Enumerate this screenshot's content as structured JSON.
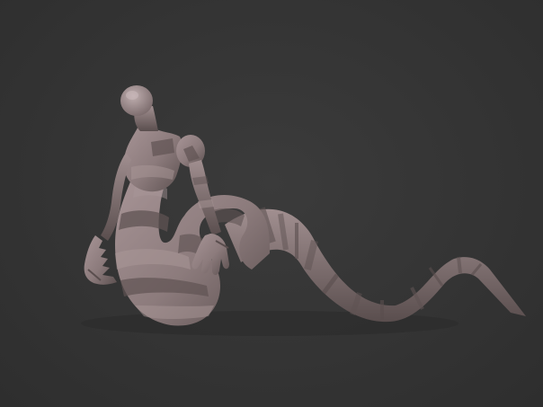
{
  "viewport": {
    "background_color": "#353535",
    "model": {
      "subject": "sculpted-serpent-creature",
      "base_color": "#8f7f80",
      "band_dark_color": "#5f5353",
      "band_light_color": "#a99798",
      "shadow_color": "#4a4040"
    }
  }
}
